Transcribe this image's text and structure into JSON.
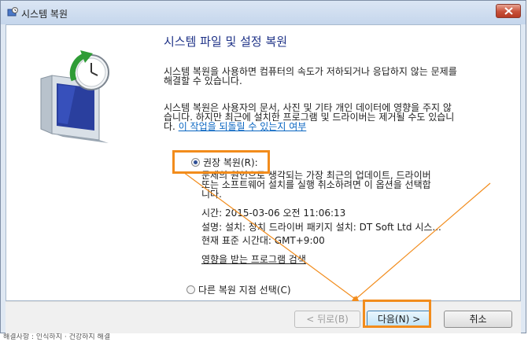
{
  "window": {
    "title": "시스템 복원"
  },
  "content": {
    "heading": "시스템 파일 및 설정 복원",
    "para1": [
      "시스템 복원을 사용하면 컴퓨터의 속도가 저하되거나 응답하지 않는 문제를",
      "해결할 수 있습니다."
    ],
    "para2": [
      "시스템 복원은 사용자의 문서, 사진 및 기타 개인 데이터에 영향을 주지 않",
      "습니다. 하지만 최근에 설치한 프로그램 및 드라이버는 제거될 수도 있습니"
    ],
    "para2_tail": "다.",
    "undo_link": "이 작업을 되돌릴 수 있는지 여부"
  },
  "recommended": {
    "label": "권장 복원(R):",
    "selected": true,
    "description": [
      "문제의 원인으로 생각되는 가장 최근의 업데이트, 드라이버",
      "또는 소프트웨어 설치를 실행 취소하려면 이 옵션을 선택합",
      "니다."
    ],
    "time": "시간: 2015-03-06 오전 11:06:13",
    "desc_line": "설명: 설치: 장치 드라이버 패키지 설치: DT Soft Ltd 시스...",
    "timezone": "현재 표준 시간대: GMT+9:00",
    "scan_link": "영향을 받는 프로그램 검색"
  },
  "other": {
    "label": "다른 복원 지점 선택(C)",
    "selected": false
  },
  "buttons": {
    "back": "< 뒤로(B)",
    "next": "다음(N) >",
    "cancel": "취소"
  },
  "background_text": "해결사항 : 인식하지 · 건강하지 해결",
  "colors": {
    "highlight": "#f28c1c",
    "heading": "#1e3287",
    "link": "#0a66c2"
  }
}
